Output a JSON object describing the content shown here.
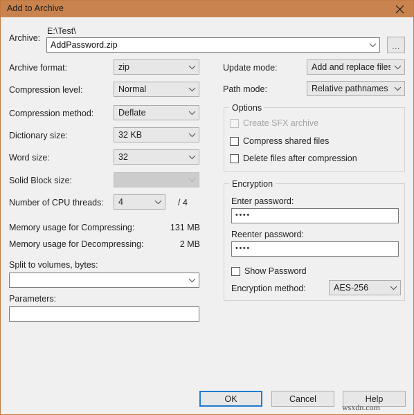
{
  "window": {
    "title": "Add to Archive",
    "close_icon": "close-icon"
  },
  "archive": {
    "label": "Archive:",
    "path": "E:\\Test\\",
    "filename": "AddPassword.zip",
    "browse_label": "..."
  },
  "left_column": {
    "archive_format": {
      "label": "Archive format:",
      "value": "zip"
    },
    "compression_level": {
      "label": "Compression level:",
      "value": "Normal"
    },
    "compression_method": {
      "label": "Compression method:",
      "value": "Deflate"
    },
    "dictionary_size": {
      "label": "Dictionary size:",
      "value": "32 KB"
    },
    "word_size": {
      "label": "Word size:",
      "value": "32"
    },
    "solid_block_size": {
      "label": "Solid Block size:",
      "value": ""
    },
    "cpu_threads": {
      "label": "Number of CPU threads:",
      "value": "4",
      "total": "/ 4"
    },
    "memory_compressing": {
      "label": "Memory usage for Compressing:",
      "value": "131 MB"
    },
    "memory_decompressing": {
      "label": "Memory usage for Decompressing:",
      "value": "2 MB"
    },
    "split_volumes": {
      "label": "Split to volumes, bytes:",
      "value": ""
    },
    "parameters": {
      "label": "Parameters:",
      "value": ""
    }
  },
  "right_column": {
    "update_mode": {
      "label": "Update mode:",
      "value": "Add and replace files"
    },
    "path_mode": {
      "label": "Path mode:",
      "value": "Relative pathnames"
    },
    "options": {
      "title": "Options",
      "items": [
        {
          "label": "Create SFX archive",
          "checked": false,
          "enabled": false
        },
        {
          "label": "Compress shared files",
          "checked": false,
          "enabled": true
        },
        {
          "label": "Delete files after compression",
          "checked": false,
          "enabled": true
        }
      ]
    },
    "encryption": {
      "title": "Encryption",
      "enter_password": {
        "label": "Enter password:",
        "value": "••••"
      },
      "reenter_password": {
        "label": "Reenter password:",
        "value": "••••"
      },
      "show_password": {
        "label": "Show Password",
        "checked": false
      },
      "method": {
        "label": "Encryption method:",
        "value": "AES-256"
      }
    }
  },
  "footer": {
    "ok": "OK",
    "cancel": "Cancel",
    "help": "Help",
    "watermark": "wsxdn.com"
  },
  "colors": {
    "titlebar": "#c8834e",
    "dialog_bg": "#f0f0f0",
    "border": "#c4793f",
    "focus_blue": "#1f7bd4"
  }
}
